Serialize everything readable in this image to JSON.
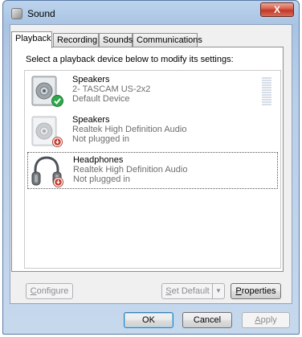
{
  "window": {
    "title": "Sound",
    "close_label": "X"
  },
  "tabs": [
    {
      "label": "Playback",
      "active": true
    },
    {
      "label": "Recording",
      "active": false
    },
    {
      "label": "Sounds",
      "active": false
    },
    {
      "label": "Communications",
      "active": false
    }
  ],
  "instruction": "Select a playback device below to modify its settings:",
  "devices": [
    {
      "name": "Speakers",
      "driver": "2- TASCAM US-2x2",
      "status": "Default Device",
      "icon": "speaker-icon",
      "badge": "default-check-icon"
    },
    {
      "name": "Speakers",
      "driver": "Realtek High Definition Audio",
      "status": "Not plugged in",
      "icon": "speaker-icon",
      "badge": "unplugged-icon"
    },
    {
      "name": "Headphones",
      "driver": "Realtek High Definition Audio",
      "status": "Not plugged in",
      "icon": "headphones-icon",
      "badge": "unplugged-icon"
    }
  ],
  "buttons": {
    "configure": {
      "label": "Configure",
      "accesskey": "C"
    },
    "set_default": {
      "label": "Set Default",
      "accesskey": "S"
    },
    "properties": {
      "label": "Properties",
      "accesskey": "P"
    },
    "ok": {
      "label": "OK"
    },
    "cancel": {
      "label": "Cancel"
    },
    "apply": {
      "label": "Apply",
      "accesskey": "A"
    }
  },
  "colors": {
    "default_check": "#2fa84a",
    "unplugged_badge": "#c0392b",
    "close_button": "#c0392b"
  }
}
